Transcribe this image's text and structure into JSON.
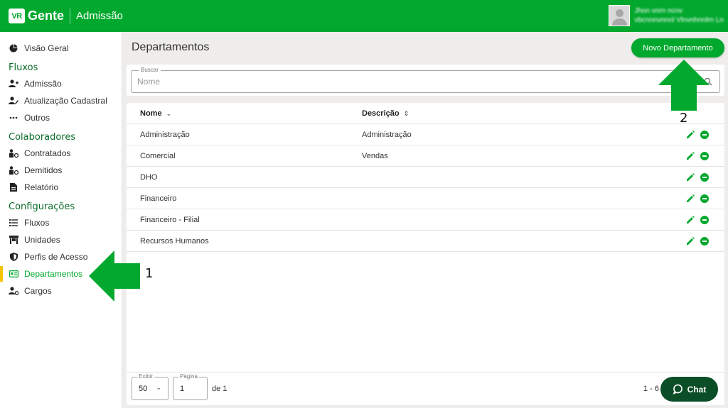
{
  "header": {
    "logo_mark": "VR",
    "logo_text": "Gente",
    "app_name": "Admissão",
    "user_name": "Jhon vnrn ncnv",
    "user_company": "vbcnnnvnnnl Vlnvnhnnlrn Ln"
  },
  "sidebar": {
    "overview": {
      "label": "Visão Geral",
      "icon": "pie-chart-icon"
    },
    "sections": {
      "flows": "Fluxos",
      "employees": "Colaboradores",
      "settings": "Configurações"
    },
    "flows_items": [
      {
        "label": "Admissão",
        "icon": "person-add-icon"
      },
      {
        "label": "Atualização Cadastral",
        "icon": "person-edit-icon"
      },
      {
        "label": "Outros",
        "icon": "more-horizontal-icon"
      }
    ],
    "employees_items": [
      {
        "label": "Contratados",
        "icon": "hired-icon"
      },
      {
        "label": "Demitidos",
        "icon": "dismissed-icon"
      },
      {
        "label": "Relatório",
        "icon": "report-icon"
      }
    ],
    "settings_items": [
      {
        "label": "Fluxos",
        "icon": "list-icon"
      },
      {
        "label": "Unidades",
        "icon": "store-icon"
      },
      {
        "label": "Perfis de Acesso",
        "icon": "shield-icon"
      },
      {
        "label": "Departamentos",
        "icon": "id-card-icon",
        "active": true
      },
      {
        "label": "Cargos",
        "icon": "person-gear-icon"
      }
    ]
  },
  "main": {
    "title": "Departamentos",
    "new_button": "Novo Departamento",
    "search": {
      "legend": "Buscar",
      "placeholder": "Nome",
      "value": ""
    },
    "table": {
      "columns": [
        "Nome",
        "Descrição"
      ],
      "rows": [
        {
          "name": "Administração",
          "description": "Administração"
        },
        {
          "name": "Comercial",
          "description": "Vendas"
        },
        {
          "name": "DHO",
          "description": ""
        },
        {
          "name": "Financeiro",
          "description": ""
        },
        {
          "name": "Financeiro - Filial",
          "description": ""
        },
        {
          "name": "Recursos Humanos",
          "description": ""
        }
      ]
    },
    "pagination": {
      "show_legend": "Exibir",
      "show_value": "50",
      "page_legend": "Página",
      "page_value": "1",
      "of_label": "de 1",
      "range": "1 - 6"
    }
  },
  "chat": {
    "label": "Chat"
  },
  "annotations": {
    "arrow1": "1",
    "arrow2": "2",
    "color": "#00a82d"
  },
  "colors": {
    "brand": "#00a82d",
    "active_marker": "#f5c400",
    "chat_bg": "#0b4d26"
  }
}
